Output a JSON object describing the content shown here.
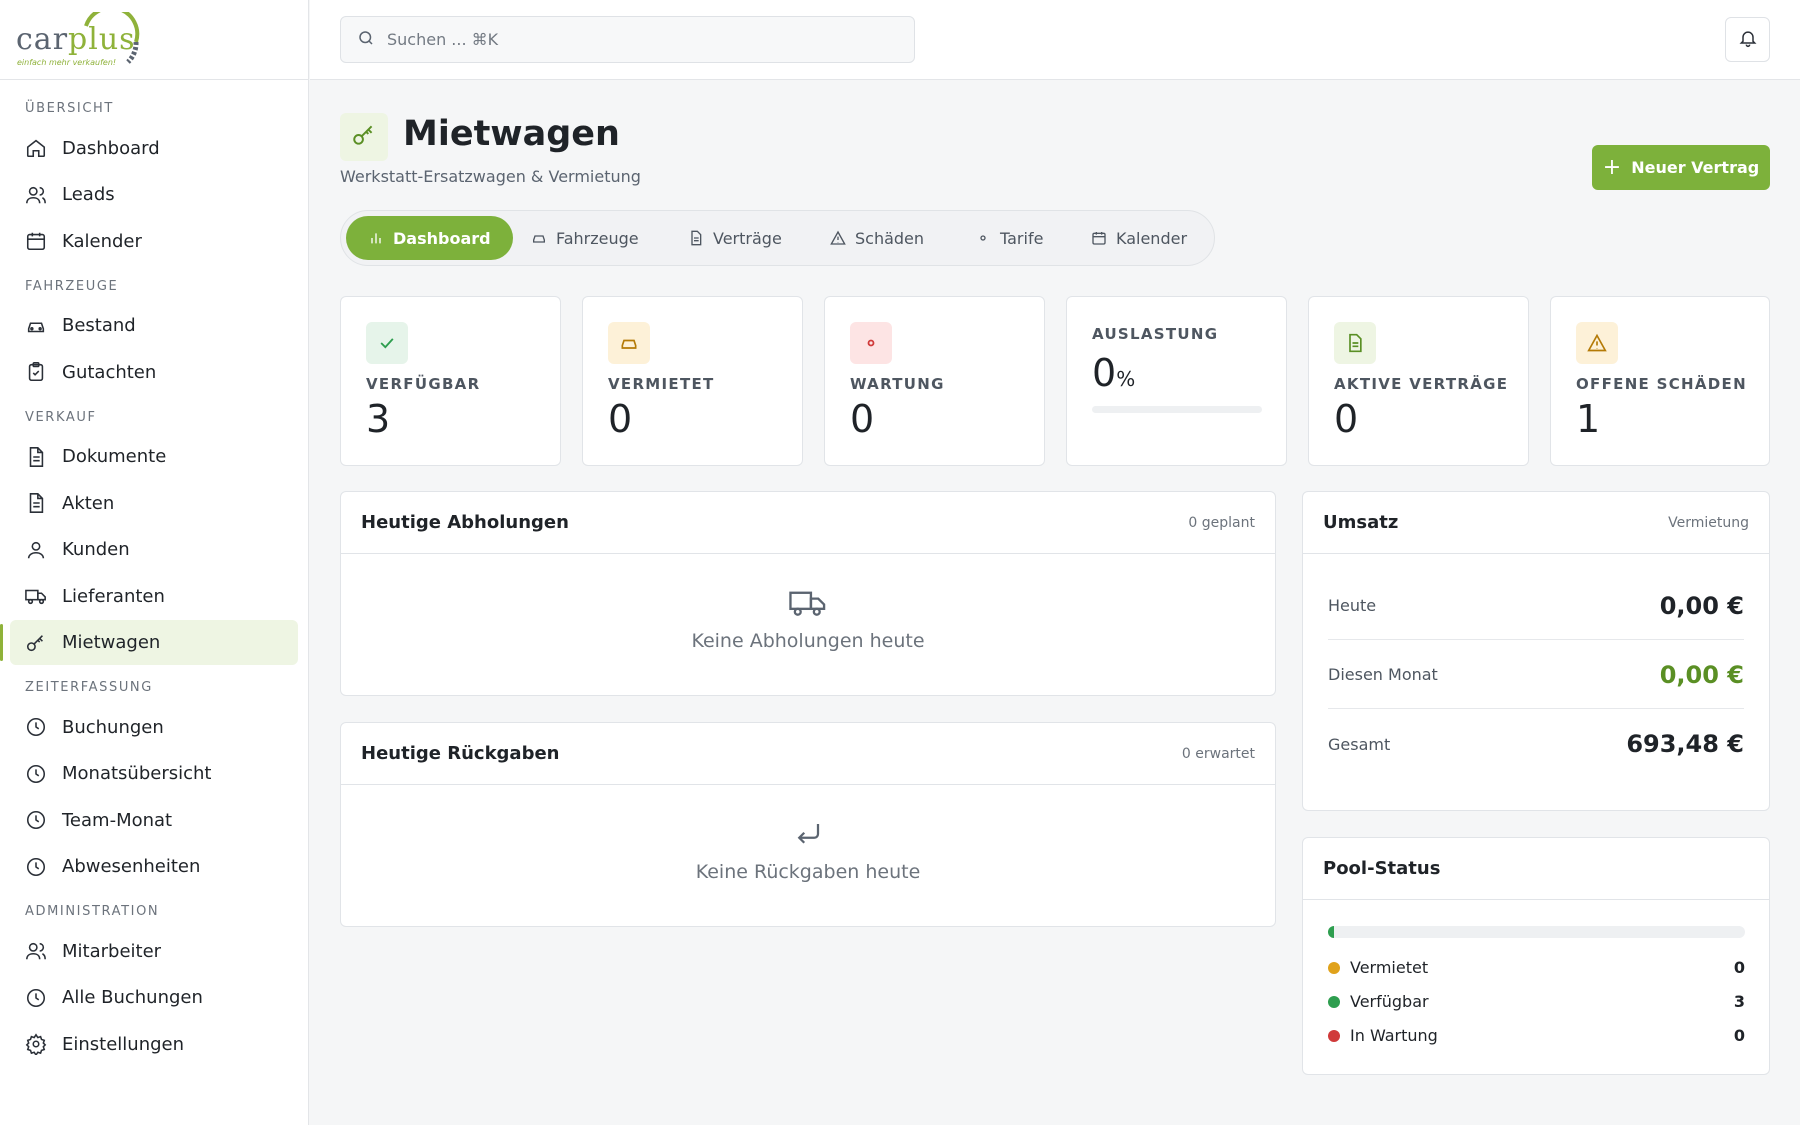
{
  "brand": {
    "logo_main": "car",
    "logo_plus": "plus",
    "logo_tagline": "einfach mehr verkaufen!",
    "accent": "#7db13b"
  },
  "sidebar": {
    "sections": [
      {
        "title": "ÜBERSICHT",
        "items": [
          {
            "label": "Dashboard",
            "icon": "home-icon"
          },
          {
            "label": "Leads",
            "icon": "users-icon"
          },
          {
            "label": "Kalender",
            "icon": "calendar-icon"
          }
        ]
      },
      {
        "title": "FAHRZEUGE",
        "items": [
          {
            "label": "Bestand",
            "icon": "car-icon"
          },
          {
            "label": "Gutachten",
            "icon": "clipboard-icon"
          }
        ]
      },
      {
        "title": "VERKAUF",
        "items": [
          {
            "label": "Dokumente",
            "icon": "document-icon"
          },
          {
            "label": "Akten",
            "icon": "document-icon"
          },
          {
            "label": "Kunden",
            "icon": "user-icon"
          },
          {
            "label": "Lieferanten",
            "icon": "truck-icon"
          },
          {
            "label": "Mietwagen",
            "icon": "key-icon",
            "active": true
          }
        ]
      },
      {
        "title": "ZEITERFASSUNG",
        "items": [
          {
            "label": "Buchungen",
            "icon": "clock-icon"
          },
          {
            "label": "Monatsübersicht",
            "icon": "clock-icon"
          },
          {
            "label": "Team-Monat",
            "icon": "clock-icon"
          },
          {
            "label": "Abwesenheiten",
            "icon": "clock-icon"
          }
        ]
      },
      {
        "title": "ADMINISTRATION",
        "items": [
          {
            "label": "Mitarbeiter",
            "icon": "users-icon"
          },
          {
            "label": "Alle Buchungen",
            "icon": "clock-icon"
          },
          {
            "label": "Einstellungen",
            "icon": "gear-icon"
          }
        ]
      }
    ]
  },
  "topbar": {
    "search_placeholder": "Suchen ... ⌘K"
  },
  "header": {
    "title": "Mietwagen",
    "subtitle": "Werkstatt-Ersatzwagen & Vermietung",
    "new_button": "Neuer Vertrag"
  },
  "tabs": [
    {
      "label": "Dashboard",
      "icon": "bar-chart-icon",
      "active": true
    },
    {
      "label": "Fahrzeuge",
      "icon": "car-icon"
    },
    {
      "label": "Verträge",
      "icon": "document-icon"
    },
    {
      "label": "Schäden",
      "icon": "warning-icon"
    },
    {
      "label": "Tarife",
      "icon": "dot-icon"
    },
    {
      "label": "Kalender",
      "icon": "calendar-icon"
    }
  ],
  "stats": [
    {
      "label": "VERFÜGBAR",
      "value": "3",
      "icon": "check-icon",
      "bg": "#e6f4ea",
      "color": "#2e9e4f"
    },
    {
      "label": "VERMIETET",
      "value": "0",
      "icon": "car-icon",
      "bg": "#fdf1d8",
      "color": "#b47a06"
    },
    {
      "label": "WARTUNG",
      "value": "0",
      "icon": "dot-icon",
      "bg": "#fde4e4",
      "color": "#d03a3a"
    },
    {
      "label": "AKTIVE VERTRÄGE",
      "value": "0",
      "icon": "document-icon",
      "bg": "#eef5e3",
      "color": "#5a8f24"
    },
    {
      "label": "OFFENE SCHÄDEN",
      "value": "1",
      "icon": "warning-icon",
      "bg": "#fdf1d8",
      "color": "#b47a06"
    }
  ],
  "auslastung": {
    "label": "AUSLASTUNG",
    "value": "0",
    "unit": "%",
    "fraction": 0
  },
  "pickups": {
    "title": "Heutige Abholungen",
    "meta": "0 geplant",
    "empty": "Keine Abholungen heute"
  },
  "returns": {
    "title": "Heutige Rückgaben",
    "meta": "0 erwartet",
    "empty": "Keine Rückgaben heute"
  },
  "revenue": {
    "title": "Umsatz",
    "meta": "Vermietung",
    "rows": [
      {
        "label": "Heute",
        "value": "0,00 €"
      },
      {
        "label": "Diesen Monat",
        "value": "0,00 €"
      },
      {
        "label": "Gesamt",
        "value": "693,48 €"
      }
    ]
  },
  "pool": {
    "title": "Pool-Status",
    "rows": [
      {
        "label": "Vermietet",
        "value": "0",
        "color": "#e0a21b"
      },
      {
        "label": "Verfügbar",
        "value": "3",
        "color": "#2e9e4f"
      },
      {
        "label": "In Wartung",
        "value": "0",
        "color": "#d03a3a"
      }
    ]
  }
}
